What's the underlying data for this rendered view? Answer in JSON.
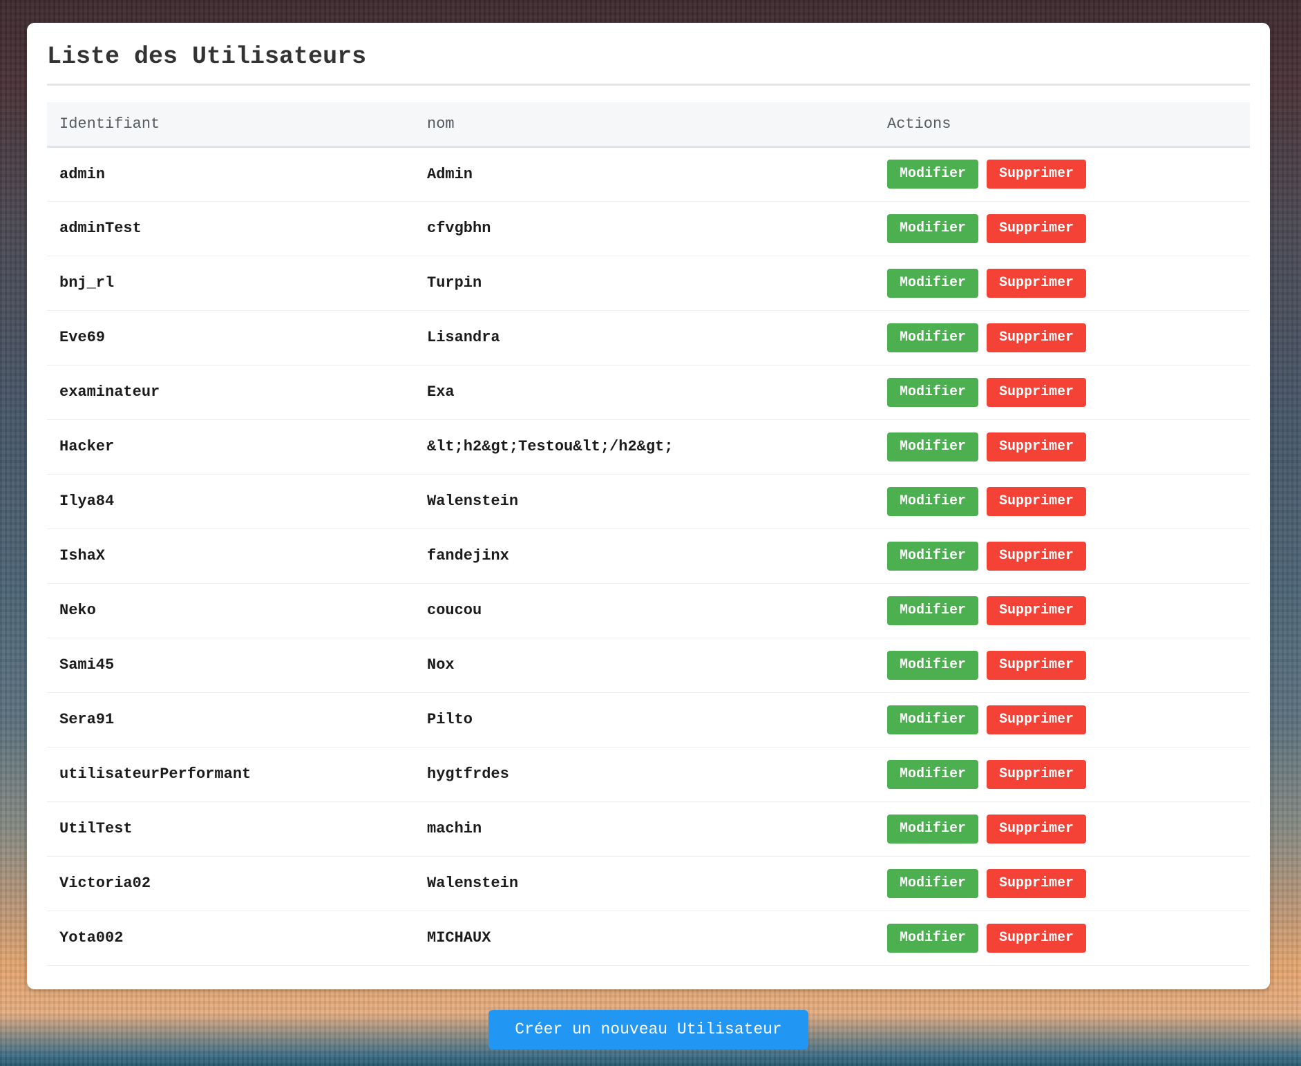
{
  "page": {
    "title": "Liste des Utilisateurs",
    "create_button": "Créer un nouveau Utilisateur"
  },
  "table": {
    "headers": [
      "Identifiant",
      "nom",
      "Actions"
    ],
    "rows": [
      {
        "id": "admin",
        "nom": "Admin"
      },
      {
        "id": "adminTest",
        "nom": "cfvgbhn"
      },
      {
        "id": "bnj_rl",
        "nom": "Turpin"
      },
      {
        "id": "Eve69",
        "nom": "Lisandra"
      },
      {
        "id": "examinateur",
        "nom": "Exa"
      },
      {
        "id": "Hacker",
        "nom": "&lt;h2&gt;Testou&lt;/h2&gt;"
      },
      {
        "id": "Ilya84",
        "nom": "Walenstein"
      },
      {
        "id": "IshaX",
        "nom": "fandejinx"
      },
      {
        "id": "Neko",
        "nom": "coucou"
      },
      {
        "id": "Sami45",
        "nom": "Nox"
      },
      {
        "id": "Sera91",
        "nom": "Pilto"
      },
      {
        "id": "utilisateurPerformant",
        "nom": "hygtfrdes"
      },
      {
        "id": "UtilTest",
        "nom": "machin"
      },
      {
        "id": "Victoria02",
        "nom": "Walenstein"
      },
      {
        "id": "Yota002",
        "nom": "MICHAUX"
      }
    ]
  },
  "actions": {
    "modify_label": "Modifier",
    "delete_label": "Supprimer"
  },
  "colors": {
    "modify": "#4caf50",
    "delete": "#f44336",
    "create": "#2196f3"
  }
}
